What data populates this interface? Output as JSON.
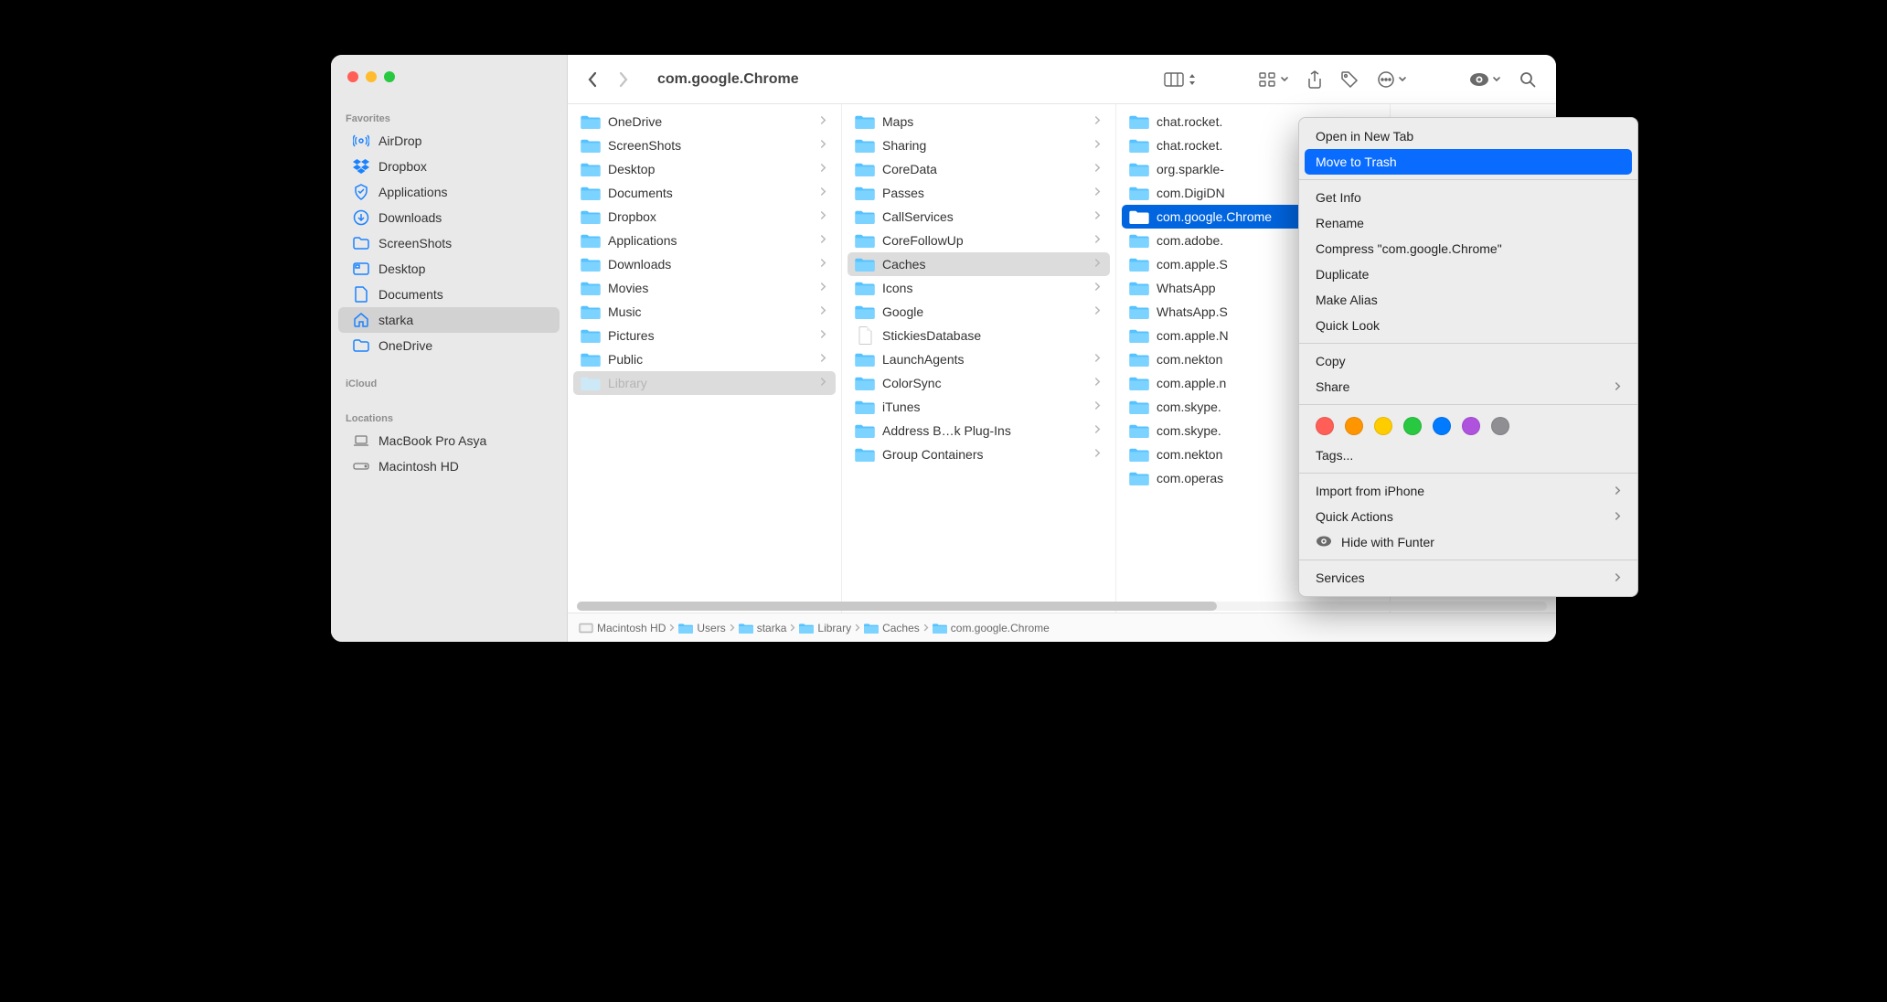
{
  "window": {
    "title": "com.google.Chrome"
  },
  "sidebar": {
    "sections": [
      {
        "title": "Favorites",
        "items": [
          {
            "icon": "airdrop",
            "label": "AirDrop"
          },
          {
            "icon": "dropbox",
            "label": "Dropbox"
          },
          {
            "icon": "apps",
            "label": "Applications"
          },
          {
            "icon": "downloads",
            "label": "Downloads"
          },
          {
            "icon": "folder",
            "label": "ScreenShots"
          },
          {
            "icon": "desktop",
            "label": "Desktop"
          },
          {
            "icon": "doc",
            "label": "Documents"
          },
          {
            "icon": "home",
            "label": "starka",
            "selected": true
          },
          {
            "icon": "folder",
            "label": "OneDrive"
          }
        ]
      },
      {
        "title": "iCloud",
        "items": []
      },
      {
        "title": "Locations",
        "items": [
          {
            "icon": "laptop",
            "label": "MacBook Pro Asya",
            "gray": true
          },
          {
            "icon": "disk",
            "label": "Macintosh HD",
            "gray": true
          }
        ]
      }
    ]
  },
  "columns": [
    {
      "items": [
        {
          "type": "folder",
          "label": "OneDrive",
          "chev": true
        },
        {
          "type": "folder",
          "label": "ScreenShots",
          "chev": true
        },
        {
          "type": "folder",
          "label": "Desktop",
          "chev": true
        },
        {
          "type": "folder",
          "label": "Documents",
          "chev": true
        },
        {
          "type": "folder",
          "label": "Dropbox",
          "chev": true
        },
        {
          "type": "folder",
          "label": "Applications",
          "chev": true
        },
        {
          "type": "folder",
          "label": "Downloads",
          "chev": true
        },
        {
          "type": "folder",
          "label": "Movies",
          "chev": true
        },
        {
          "type": "folder",
          "label": "Music",
          "chev": true
        },
        {
          "type": "folder",
          "label": "Pictures",
          "chev": true
        },
        {
          "type": "folder",
          "label": "Public",
          "chev": true
        },
        {
          "type": "folder",
          "label": "Library",
          "chev": true,
          "muted": true,
          "navsel": true
        }
      ]
    },
    {
      "items": [
        {
          "type": "folder",
          "label": "Maps",
          "chev": true
        },
        {
          "type": "folder",
          "label": "Sharing",
          "chev": true
        },
        {
          "type": "folder",
          "label": "CoreData",
          "chev": true
        },
        {
          "type": "folder",
          "label": "Passes",
          "chev": true
        },
        {
          "type": "folder",
          "label": "CallServices",
          "chev": true
        },
        {
          "type": "folder",
          "label": "CoreFollowUp",
          "chev": true
        },
        {
          "type": "folder",
          "label": "Caches",
          "chev": true,
          "navsel": true
        },
        {
          "type": "folder",
          "label": "Icons",
          "chev": true
        },
        {
          "type": "folder",
          "label": "Google",
          "chev": true
        },
        {
          "type": "file",
          "label": "StickiesDatabase"
        },
        {
          "type": "folder",
          "label": "LaunchAgents",
          "chev": true
        },
        {
          "type": "folder",
          "label": "ColorSync",
          "chev": true
        },
        {
          "type": "folder",
          "label": "iTunes",
          "chev": true
        },
        {
          "type": "folder",
          "label": "Address B…k Plug-Ins",
          "chev": true
        },
        {
          "type": "folder",
          "label": "Group Containers",
          "chev": true
        }
      ]
    },
    {
      "items": [
        {
          "type": "folder",
          "label": "chat.rocket."
        },
        {
          "type": "folder",
          "label": "chat.rocket."
        },
        {
          "type": "folder",
          "label": "org.sparkle-"
        },
        {
          "type": "folder",
          "label": "com.DigiDN"
        },
        {
          "type": "folder",
          "label": "com.google.",
          "sel": true,
          "full": "com.google.Chrome"
        },
        {
          "type": "folder",
          "label": "com.adobe."
        },
        {
          "type": "folder",
          "label": "com.apple.S"
        },
        {
          "type": "folder",
          "label": "WhatsApp"
        },
        {
          "type": "folder",
          "label": "WhatsApp.S"
        },
        {
          "type": "folder",
          "label": "com.apple.N"
        },
        {
          "type": "folder",
          "label": "com.nekton"
        },
        {
          "type": "folder",
          "label": "com.apple.n"
        },
        {
          "type": "folder",
          "label": "com.skype."
        },
        {
          "type": "folder",
          "label": "com.skype."
        },
        {
          "type": "folder",
          "label": "com.nekton"
        },
        {
          "type": "folder",
          "label": "com.operas"
        }
      ]
    }
  ],
  "pathbar": [
    {
      "icon": "hd",
      "label": "Macintosh HD"
    },
    {
      "icon": "folder",
      "label": "Users"
    },
    {
      "icon": "folder",
      "label": "starka"
    },
    {
      "icon": "folder",
      "label": "Library"
    },
    {
      "icon": "folder",
      "label": "Caches"
    },
    {
      "icon": "folder",
      "label": "com.google.Chrome"
    }
  ],
  "context_menu": {
    "groups": [
      [
        {
          "label": "Open in New Tab"
        },
        {
          "label": "Move to Trash",
          "highlight": true
        }
      ],
      [
        {
          "label": "Get Info"
        },
        {
          "label": "Rename"
        },
        {
          "label": "Compress \"com.google.Chrome\""
        },
        {
          "label": "Duplicate"
        },
        {
          "label": "Make Alias"
        },
        {
          "label": "Quick Look"
        }
      ],
      [
        {
          "label": "Copy"
        },
        {
          "label": "Share",
          "sub": true
        }
      ],
      [
        {
          "type": "tags"
        },
        {
          "label": "Tags..."
        }
      ],
      [
        {
          "label": "Import from iPhone",
          "sub": true
        },
        {
          "label": "Quick Actions",
          "sub": true
        },
        {
          "label": "Hide with Funter",
          "eye": true
        }
      ],
      [
        {
          "label": "Services",
          "sub": true
        }
      ]
    ],
    "tag_colors": [
      "#ff5f57",
      "#ff9500",
      "#ffcc00",
      "#28c840",
      "#007aff",
      "#af52de",
      "#8e8e93"
    ]
  }
}
